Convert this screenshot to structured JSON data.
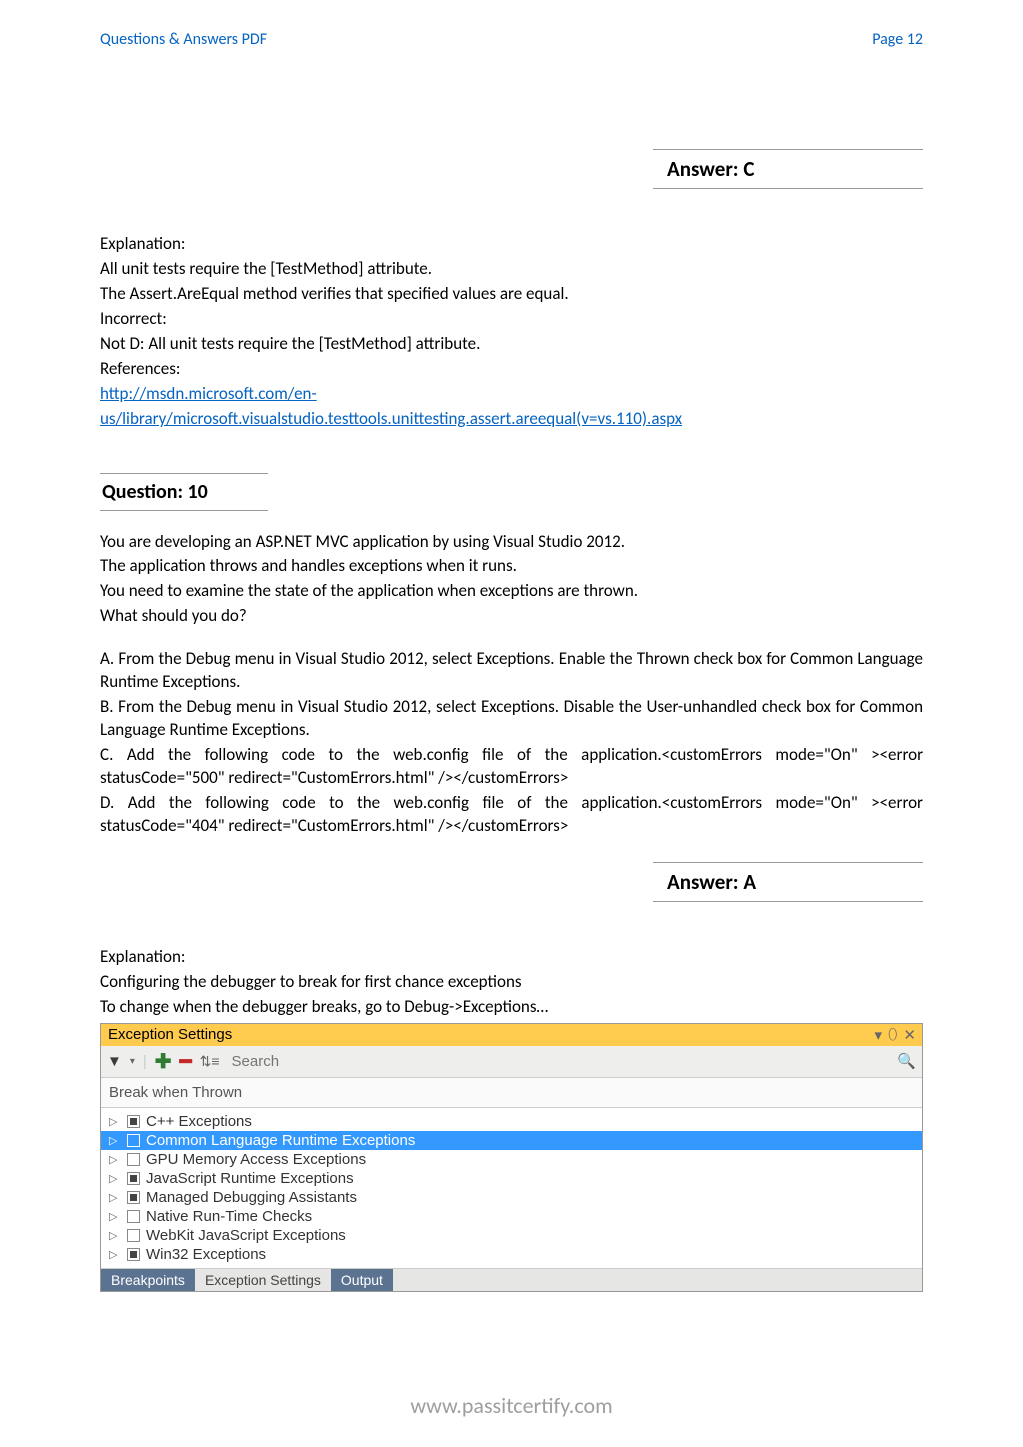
{
  "header": {
    "left": "Questions & Answers PDF",
    "right": "Page 12"
  },
  "answer9": {
    "label": "Answer: C"
  },
  "explanation9": {
    "title": "Explanation:",
    "line1": "All unit tests require the [TestMethod] attribute.",
    "line2": "The Assert.AreEqual method verifies that specified values are equal.",
    "line3": "Incorrect:",
    "line4": "Not D: All unit tests require the [TestMethod] attribute.",
    "line5": "References:",
    "link1": "http://msdn.microsoft.com/en-",
    "link2": "us/library/microsoft.visualstudio.testtools.unittesting.assert.areequal(v=vs.110).aspx"
  },
  "question10": {
    "heading": "Question: 10",
    "stem1": "You are developing an ASP.NET MVC application by using Visual Studio 2012.",
    "stem2": "The application throws and handles exceptions when it runs.",
    "stem3": "You need to examine the state of the application when exceptions are thrown.",
    "stem4": "What should you do?",
    "optA": "A. From the Debug menu in Visual Studio 2012, select Exceptions. Enable the Thrown check box for Common Language Runtime Exceptions.",
    "optB": "B. From the Debug menu in Visual Studio 2012, select Exceptions. Disable the User-unhandled check box for Common Language Runtime Exceptions.",
    "optC": "C. Add the following code to the web.config file of the application.<customErrors mode=\"On\" ><error statusCode=\"500\" redirect=\"CustomErrors.html\" /></customErrors>",
    "optD": "D. Add the following code to the web.config file of the application.<customErrors mode=\"On\" ><error statusCode=\"404\" redirect=\"CustomErrors.html\" /></customErrors>"
  },
  "answer10": {
    "label": "Answer: A"
  },
  "explanation10": {
    "title": "Explanation:",
    "line1": "Configuring the debugger to break for first chance exceptions",
    "line2": "To change when the debugger breaks, go to Debug->Exceptions…"
  },
  "exceptionPanel": {
    "title": "Exception Settings",
    "searchPlaceholder": "Search",
    "breakLabel": "Break when Thrown",
    "items": [
      {
        "label": "C++ Exceptions",
        "state": "partial",
        "selected": false
      },
      {
        "label": "Common Language Runtime Exceptions",
        "state": "empty",
        "selected": true
      },
      {
        "label": "GPU Memory Access Exceptions",
        "state": "empty",
        "selected": false
      },
      {
        "label": "JavaScript Runtime Exceptions",
        "state": "partial",
        "selected": false
      },
      {
        "label": "Managed Debugging Assistants",
        "state": "partial",
        "selected": false
      },
      {
        "label": "Native Run-Time Checks",
        "state": "empty",
        "selected": false
      },
      {
        "label": "WebKit JavaScript Exceptions",
        "state": "empty",
        "selected": false
      },
      {
        "label": "Win32 Exceptions",
        "state": "partial",
        "selected": false
      }
    ],
    "tabs": {
      "breakpoints": "Breakpoints",
      "exceptionSettings": "Exception Settings",
      "output": "Output"
    }
  },
  "footer": "www.passitcertify.com"
}
